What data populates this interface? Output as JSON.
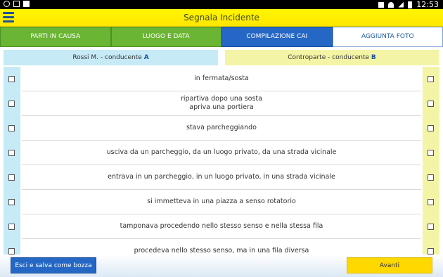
{
  "statusbar": {
    "time": "12:53",
    "left_icons": [
      "location-icon",
      "image-icon",
      "download-icon"
    ],
    "right_icons": [
      "mute-icon",
      "wifi-icon",
      "signal-icon",
      "battery-icon"
    ]
  },
  "header": {
    "title": "Segnala Incidente",
    "menu_icon": "menu-icon"
  },
  "tabs": [
    {
      "label": "PARTI IN CAUSA",
      "state": "done"
    },
    {
      "label": "LUOGO E DATA",
      "state": "done"
    },
    {
      "label": "COMPILAZIONE CAI",
      "state": "active"
    },
    {
      "label": "AGGIUNTA FOTO",
      "state": "pending"
    }
  ],
  "party_a": {
    "name": "Rossi M. - conducente ",
    "letter": "A"
  },
  "party_b": {
    "name": "Controparte - conducente ",
    "letter": "B"
  },
  "circumstances": [
    {
      "lines": [
        "in fermata/sosta"
      ]
    },
    {
      "lines": [
        "ripartiva dopo una sosta",
        "apriva una portiera"
      ]
    },
    {
      "lines": [
        "stava parcheggiando"
      ]
    },
    {
      "lines": [
        "usciva da un parcheggio, da un luogo privato, da una strada vicinale"
      ]
    },
    {
      "lines": [
        "entrava in un parcheggio, in un luogo privato, in una strada vicinale"
      ]
    },
    {
      "lines": [
        "si immetteva in una piazza a senso rotatorio"
      ]
    },
    {
      "lines": [
        "tamponava procedendo nello stesso senso e nella stessa fila"
      ]
    },
    {
      "lines": [
        "procedeva nello stesso senso, ma in una fila diversa"
      ]
    }
  ],
  "footer": {
    "draft_button": "Esci e salva come bozza",
    "next_button": "Avanti"
  },
  "colors": {
    "yellow": "#ffe600",
    "green": "#6ab533",
    "blue": "#2567c4",
    "light_blue": "#c6eaf6",
    "light_yellow": "#f4f4a6"
  }
}
